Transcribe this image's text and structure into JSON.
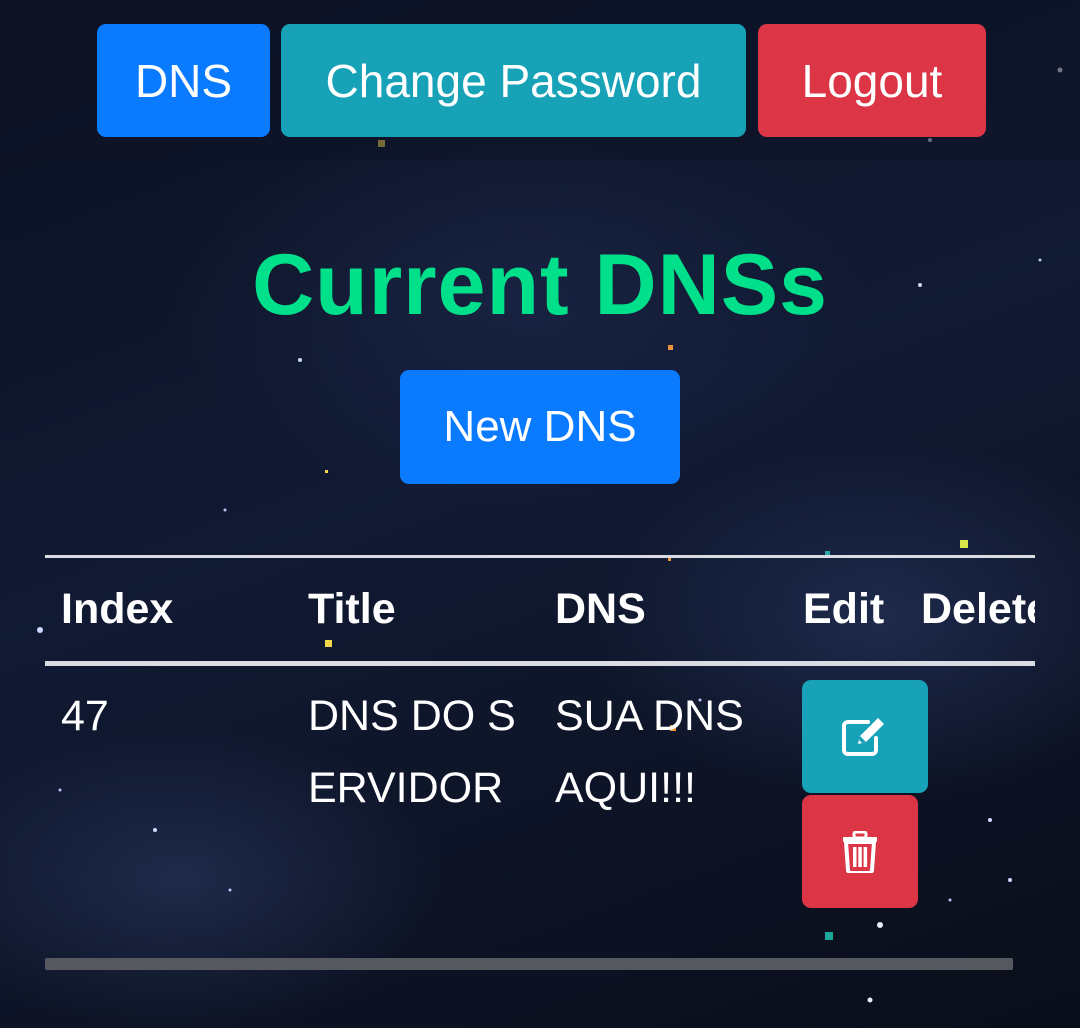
{
  "nav": {
    "dns_label": "DNS",
    "change_password_label": "Change Password",
    "logout_label": "Logout"
  },
  "page": {
    "title": "Current DNSs",
    "new_dns_label": "New DNS"
  },
  "table": {
    "headers": {
      "index": "Index",
      "title": "Title",
      "dns": "DNS",
      "edit": "Edit",
      "delete": "Delete"
    },
    "rows": [
      {
        "index": "47",
        "title": "DNS DO SERVIDOR",
        "dns": "SUA DNS AQUI!!!"
      }
    ]
  },
  "icons": {
    "edit": "edit-icon",
    "delete": "trash-icon"
  },
  "colors": {
    "primary": "#0a7bff",
    "info": "#17a2b8",
    "danger": "#dc3545",
    "title": "#00e08a"
  }
}
